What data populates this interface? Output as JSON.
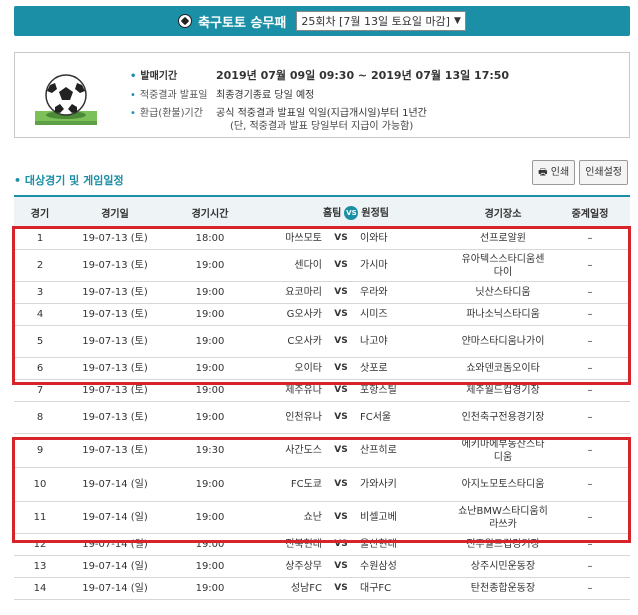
{
  "header": {
    "title": "축구토토 승무패",
    "round": "25회차 [7월 13일 토요일 마감]"
  },
  "info": {
    "rows": [
      {
        "label": "발매기간",
        "value": "2019년 07월 09일 09:30 ~ 2019년 07월 13일 17:50"
      },
      {
        "label": "적중결과 발표일",
        "value": "최종경기종료 당일 예정"
      },
      {
        "label": "환급(환불)기간",
        "value": "공식 적중결과 발표일 익일(지급개시일)부터 1년간"
      }
    ],
    "note": "(단, 적중결과 발표 당일부터 지급이 가능함)"
  },
  "section_title": "• 대상경기 및 게임일정",
  "buttons": {
    "print": "인쇄",
    "print_settings": "인쇄설정"
  },
  "table": {
    "headers": {
      "no": "경기",
      "date": "경기일",
      "time": "경기시간",
      "home": "홈팀",
      "vs": "VS",
      "away": "원정팀",
      "venue": "경기장소",
      "cancel": "중계일정"
    },
    "rows": [
      {
        "no": "1",
        "date": "19-07-13 (토)",
        "time": "18:00",
        "home": "마쓰모토",
        "vs": "VS",
        "away": "이와타",
        "venue": "선프로알윈",
        "cancel": "–"
      },
      {
        "no": "2",
        "date": "19-07-13 (토)",
        "time": "19:00",
        "home": "센다이",
        "vs": "VS",
        "away": "가시마",
        "venue": "유아텍스스타디움센다이",
        "cancel": "–"
      },
      {
        "no": "3",
        "date": "19-07-13 (토)",
        "time": "19:00",
        "home": "요코마리",
        "vs": "VS",
        "away": "우라와",
        "venue": "닛산스타디움",
        "cancel": "–"
      },
      {
        "no": "4",
        "date": "19-07-13 (토)",
        "time": "19:00",
        "home": "G오사카",
        "vs": "VS",
        "away": "시미즈",
        "venue": "파나소닉스타디움",
        "cancel": "–"
      },
      {
        "no": "5",
        "date": "19-07-13 (토)",
        "time": "19:00",
        "home": "C오사카",
        "vs": "VS",
        "away": "나고야",
        "venue": "얀마스타디움나가이",
        "cancel": "–"
      },
      {
        "no": "6",
        "date": "19-07-13 (토)",
        "time": "19:00",
        "home": "오이타",
        "vs": "VS",
        "away": "삿포로",
        "venue": "쇼와덴코돔오이타",
        "cancel": "–"
      },
      {
        "no": "7",
        "date": "19-07-13 (토)",
        "time": "19:00",
        "home": "제주유나",
        "vs": "VS",
        "away": "포항스틸",
        "venue": "제주월드컵경기장",
        "cancel": "–"
      },
      {
        "no": "8",
        "date": "19-07-13 (토)",
        "time": "19:00",
        "home": "인천유나",
        "vs": "VS",
        "away": "FC서울",
        "venue": "인천축구전용경기장",
        "cancel": "–"
      },
      {
        "no": "9",
        "date": "19-07-13 (토)",
        "time": "19:30",
        "home": "사간도스",
        "vs": "VS",
        "away": "산프히로",
        "venue": "에키마에부동산스타디움",
        "cancel": "–"
      },
      {
        "no": "10",
        "date": "19-07-14 (일)",
        "time": "19:00",
        "home": "FC도쿄",
        "vs": "VS",
        "away": "가와사키",
        "venue": "아지노모토스타디움",
        "cancel": "–"
      },
      {
        "no": "11",
        "date": "19-07-14 (일)",
        "time": "19:00",
        "home": "쇼난",
        "vs": "VS",
        "away": "비셀고베",
        "venue": "쇼난BMW스타디움히라쓰카",
        "cancel": "–"
      },
      {
        "no": "12",
        "date": "19-07-14 (일)",
        "time": "19:00",
        "home": "전북현대",
        "vs": "VS",
        "away": "울산현대",
        "venue": "전주월드컵경기장",
        "cancel": "–"
      },
      {
        "no": "13",
        "date": "19-07-14 (일)",
        "time": "19:00",
        "home": "상주상무",
        "vs": "VS",
        "away": "수원삼성",
        "venue": "상주시민운동장",
        "cancel": "–"
      },
      {
        "no": "14",
        "date": "19-07-14 (일)",
        "time": "19:00",
        "home": "성남FC",
        "vs": "VS",
        "away": "대구FC",
        "venue": "탄천종합운동장",
        "cancel": "–"
      }
    ]
  },
  "colors": {
    "accent": "#1b8fa6",
    "highlight": "#d7232a"
  }
}
